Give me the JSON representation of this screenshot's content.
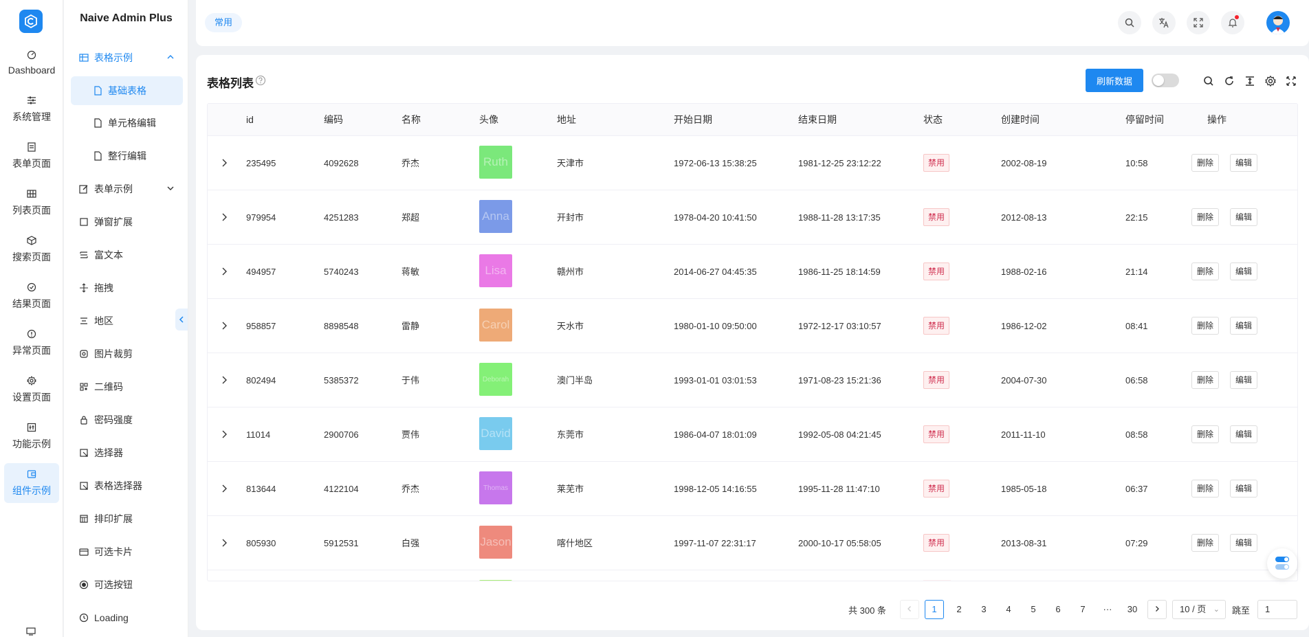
{
  "rail": {
    "items": [
      {
        "label": "Dashboard",
        "icon": "dashboard-icon"
      },
      {
        "label": "系统管理",
        "icon": "sliders-icon"
      },
      {
        "label": "表单页面",
        "icon": "form-icon"
      },
      {
        "label": "列表页面",
        "icon": "grid-icon"
      },
      {
        "label": "搜索页面",
        "icon": "cube-icon"
      },
      {
        "label": "结果页面",
        "icon": "check-circle-icon"
      },
      {
        "label": "异常页面",
        "icon": "exclamation-circle-icon"
      },
      {
        "label": "设置页面",
        "icon": "gear-icon"
      },
      {
        "label": "功能示例",
        "icon": "function-icon"
      },
      {
        "label": "组件示例",
        "icon": "component-icon"
      }
    ]
  },
  "submenu": {
    "brand": "Naive Admin Plus",
    "group_table": "表格示例",
    "table_children": [
      "基础表格",
      "单元格编辑",
      "整行编辑"
    ],
    "group_form": "表单示例",
    "items": [
      "弹窗扩展",
      "富文本",
      "拖拽",
      "地区",
      "图片裁剪",
      "二维码",
      "密码强度",
      "选择器",
      "表格选择器",
      "排印扩展",
      "可选卡片",
      "可选按钮",
      "Loading"
    ]
  },
  "topbar": {
    "tag": "常用"
  },
  "card": {
    "title": "表格列表",
    "refresh_label": "刷新数据"
  },
  "table": {
    "headers": [
      "id",
      "编码",
      "名称",
      "头像",
      "地址",
      "开始日期",
      "结束日期",
      "状态",
      "创建时间",
      "停留时间",
      "操作"
    ],
    "rows": [
      {
        "id": "235495",
        "code": "4092628",
        "name": "乔杰",
        "avatar_text": "Ruth",
        "avatar_color": "#7be87b",
        "address": "天津市",
        "start": "1972-06-13 15:38:25",
        "end": "1981-12-25 23:12:22",
        "status": "禁用",
        "created": "2002-08-19",
        "stay": "10:58"
      },
      {
        "id": "979954",
        "code": "4251283",
        "name": "郑超",
        "avatar_text": "Anna",
        "avatar_color": "#7b9ae8",
        "address": "开封市",
        "start": "1978-04-20 10:41:50",
        "end": "1988-11-28 13:17:35",
        "status": "禁用",
        "created": "2012-08-13",
        "stay": "22:15"
      },
      {
        "id": "494957",
        "code": "5740243",
        "name": "蒋敏",
        "avatar_text": "Lisa",
        "avatar_color": "#ea79e6",
        "address": "赣州市",
        "start": "2014-06-27 04:45:35",
        "end": "1986-11-25 18:14:59",
        "status": "禁用",
        "created": "1988-02-16",
        "stay": "21:14"
      },
      {
        "id": "958857",
        "code": "8898548",
        "name": "雷静",
        "avatar_text": "Carol",
        "avatar_color": "#eeaa77",
        "address": "天水市",
        "start": "1980-01-10 09:50:00",
        "end": "1972-12-17 03:10:57",
        "status": "禁用",
        "created": "1986-12-02",
        "stay": "08:41"
      },
      {
        "id": "802494",
        "code": "5385372",
        "name": "于伟",
        "avatar_text": "Deborah",
        "avatar_color": "#84f077",
        "address": "澳门半岛",
        "start": "1993-01-01 03:01:53",
        "end": "1971-08-23 15:21:36",
        "status": "禁用",
        "created": "2004-07-30",
        "stay": "06:58"
      },
      {
        "id": "11014",
        "code": "2900706",
        "name": "贾伟",
        "avatar_text": "David",
        "avatar_color": "#79cbee",
        "address": "东莞市",
        "start": "1986-04-07 18:01:09",
        "end": "1992-05-08 04:21:45",
        "status": "禁用",
        "created": "2011-11-10",
        "stay": "08:58"
      },
      {
        "id": "813644",
        "code": "4122104",
        "name": "乔杰",
        "avatar_text": "Thomas",
        "avatar_color": "#c777ec",
        "address": "莱芜市",
        "start": "1998-12-05 14:16:55",
        "end": "1995-11-28 11:47:10",
        "status": "禁用",
        "created": "1985-05-18",
        "stay": "06:37"
      },
      {
        "id": "805930",
        "code": "5912531",
        "name": "白强",
        "avatar_text": "Jason",
        "avatar_color": "#ee8a7d",
        "address": "喀什地区",
        "start": "1997-11-07 22:31:17",
        "end": "2000-10-17 05:58:05",
        "status": "禁用",
        "created": "2013-08-31",
        "stay": "07:29"
      }
    ],
    "partial_row_avatar_color": "#a9ee77",
    "delete_label": "删除",
    "edit_label": "编辑"
  },
  "pagination": {
    "total": "共 300 条",
    "pages": [
      "1",
      "2",
      "3",
      "4",
      "5",
      "6",
      "7",
      "···",
      "30"
    ],
    "current": "1",
    "page_size": "10 / 页",
    "jump_label": "跳至",
    "jump_value": "1"
  },
  "colors": {
    "primary": "#1e88f0",
    "danger": "#d03050"
  }
}
